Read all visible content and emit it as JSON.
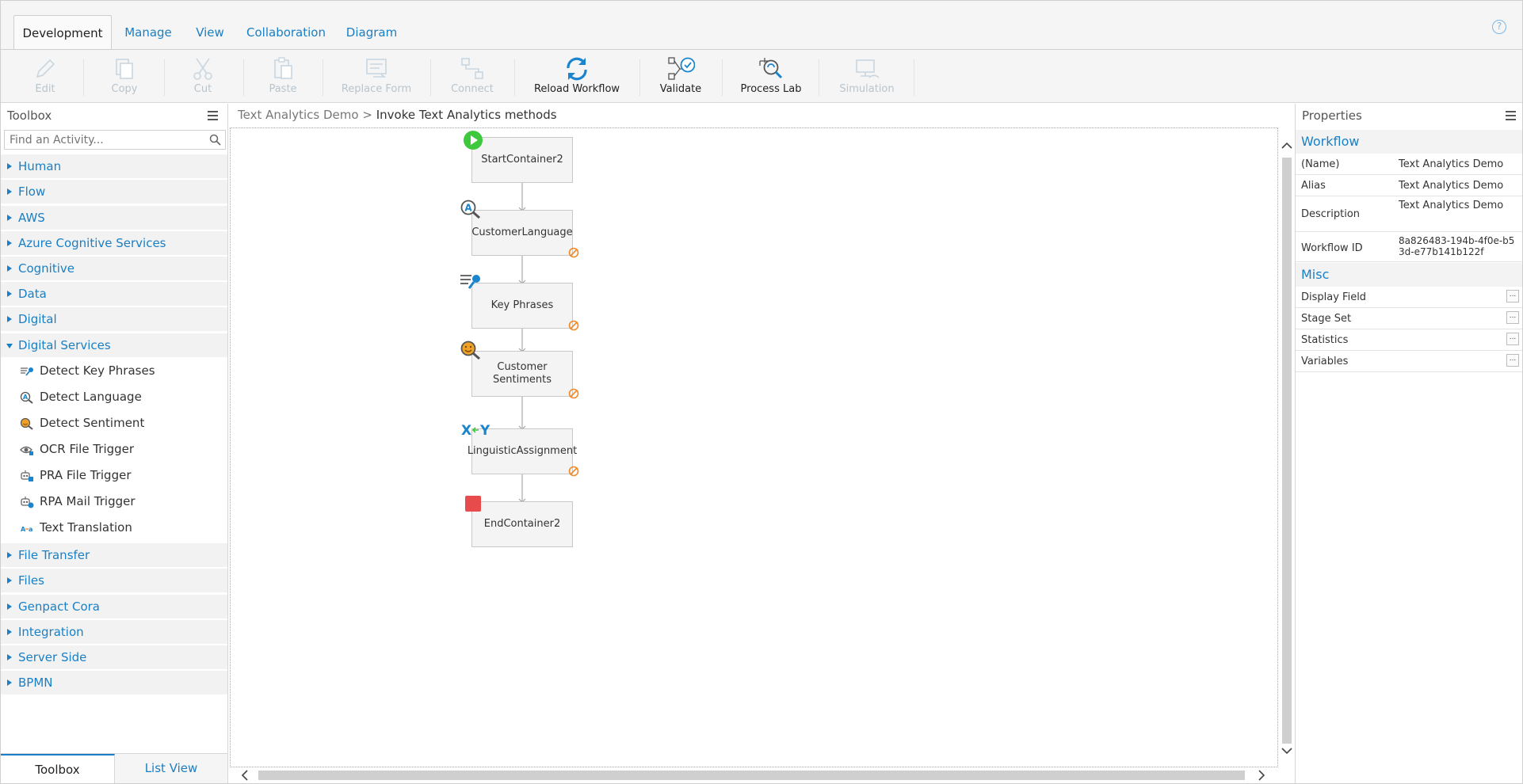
{
  "tabs": [
    {
      "label": "Development",
      "active": true
    },
    {
      "label": "Manage"
    },
    {
      "label": "View"
    },
    {
      "label": "Collaboration"
    },
    {
      "label": "Diagram"
    }
  ],
  "ribbon": {
    "edit": "Edit",
    "copy": "Copy",
    "cut": "Cut",
    "paste": "Paste",
    "replace_form": "Replace Form",
    "connect": "Connect",
    "reload_workflow": "Reload Workflow",
    "validate": "Validate",
    "process_lab": "Process Lab",
    "simulation": "Simulation"
  },
  "toolbox": {
    "title": "Toolbox",
    "search_placeholder": "Find an Activity...",
    "categories": [
      "Human",
      "Flow",
      "AWS",
      "Azure Cognitive Services",
      "Cognitive",
      "Data",
      "Digital",
      "Digital Services",
      "File Transfer",
      "Files",
      "Genpact Cora",
      "Integration",
      "Server Side",
      "BPMN"
    ],
    "expanded_category": "Digital Services",
    "activities": [
      {
        "label": "Detect Key Phrases",
        "icon": "key-phrases-icon"
      },
      {
        "label": "Detect Language",
        "icon": "detect-language-icon"
      },
      {
        "label": "Detect Sentiment",
        "icon": "sentiment-icon"
      },
      {
        "label": "OCR File Trigger",
        "icon": "ocr-icon"
      },
      {
        "label": "PRA File Trigger",
        "icon": "robot-file-icon"
      },
      {
        "label": "RPA Mail Trigger",
        "icon": "robot-mail-icon"
      },
      {
        "label": "Text Translation",
        "icon": "translation-icon"
      }
    ],
    "bottom_tabs": [
      "Toolbox",
      "List View"
    ]
  },
  "breadcrumb": {
    "root": "Text Analytics Demo",
    "separator": ">",
    "current": "Invoke Text Analytics methods"
  },
  "workflow": {
    "nodes": [
      {
        "label": "StartContainer2",
        "icon": "start-play-icon"
      },
      {
        "label": "CustomerLanguage",
        "icon": "detect-language-icon",
        "warning": true
      },
      {
        "label": "Key Phrases",
        "icon": "key-phrases-icon",
        "warning": true
      },
      {
        "label": "Customer Sentiments",
        "icon": "sentiment-icon",
        "warning": true
      },
      {
        "label": "LinguisticAssignment",
        "icon": "xy-assignment-icon",
        "warning": true
      },
      {
        "label": "EndContainer2",
        "icon": "end-stop-icon"
      }
    ]
  },
  "properties": {
    "title": "Properties",
    "workflow_section": "Workflow",
    "rows": [
      {
        "key": "(Name)",
        "value": "Text Analytics Demo"
      },
      {
        "key": "Alias",
        "value": "Text Analytics Demo"
      },
      {
        "key": "Description",
        "value": "Text Analytics Demo"
      },
      {
        "key": "Workflow ID",
        "value": "8a826483-194b-4f0e-b53d-e77b141b122f"
      }
    ],
    "misc_section": "Misc",
    "misc_rows": [
      "Display Field",
      "Stage Set",
      "Statistics",
      "Variables"
    ],
    "ellipsis": "..."
  },
  "colors": {
    "accent": "#1a7fc4",
    "start": "#3ec83e",
    "end": "#e84b4b",
    "warning": "#f08a2c"
  }
}
